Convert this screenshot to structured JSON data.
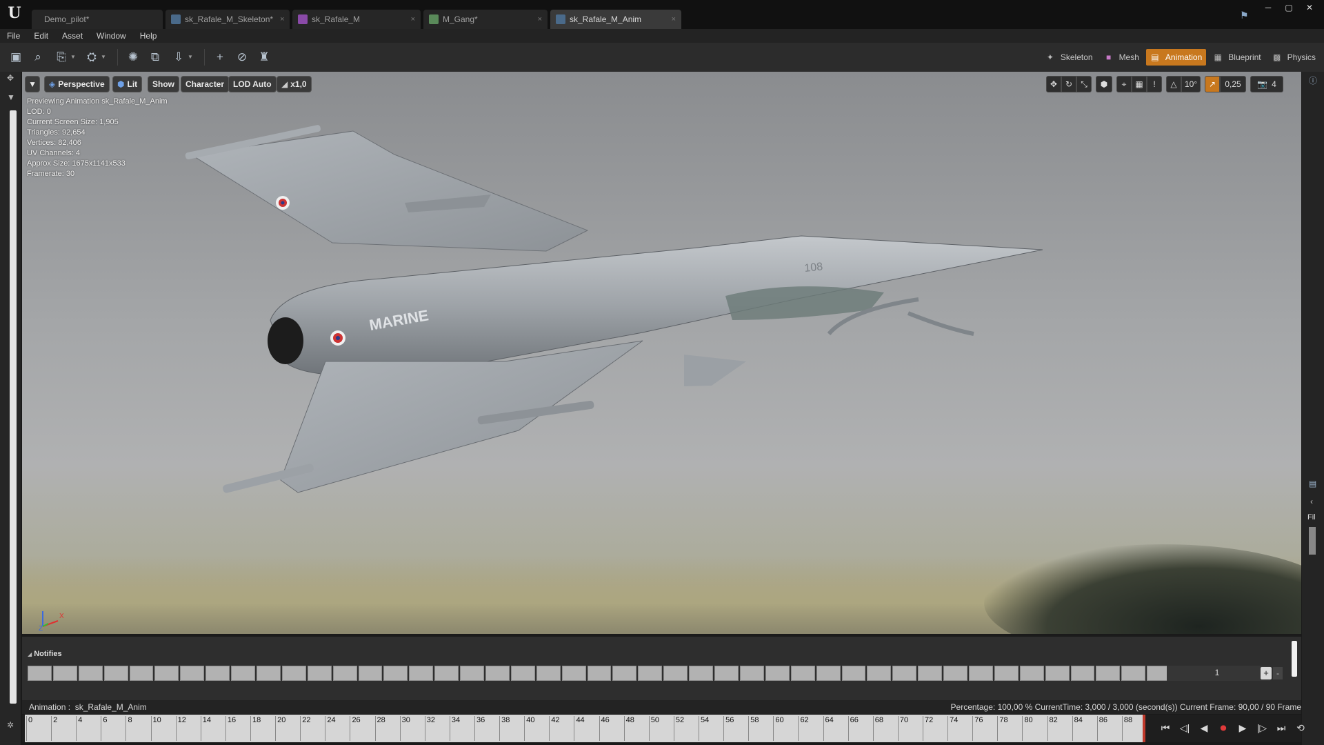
{
  "app": {
    "logo_text": "U"
  },
  "tabs": [
    {
      "label": "Demo_pilot*",
      "icon_color": "#3a3a3a",
      "close": ""
    },
    {
      "label": "sk_Rafale_M_Skeleton*",
      "icon_color": "#4a6a8a",
      "close": "×"
    },
    {
      "label": "sk_Rafale_M",
      "icon_color": "#8a4aa8",
      "close": "×"
    },
    {
      "label": "M_Gang*",
      "icon_color": "#5a8a5a",
      "close": "×"
    },
    {
      "label": "sk_Rafale_M_Anim",
      "icon_color": "#4a6a8a",
      "close": "×"
    }
  ],
  "menu": [
    "File",
    "Edit",
    "Asset",
    "Window",
    "Help"
  ],
  "modes": [
    {
      "label": "Skeleton",
      "icon": "skeleton-icon",
      "active": false
    },
    {
      "label": "Mesh",
      "icon": "mesh-icon",
      "active": false
    },
    {
      "label": "Animation",
      "icon": "animation-icon",
      "active": true
    },
    {
      "label": "Blueprint",
      "icon": "blueprint-icon",
      "active": false
    },
    {
      "label": "Physics",
      "icon": "physics-icon",
      "active": false
    }
  ],
  "viewport": {
    "buttons": {
      "perspective": "Perspective",
      "lit": "Lit",
      "show": "Show",
      "character": "Character",
      "lod": "LOD Auto",
      "speed": "x1,0"
    },
    "right_controls": {
      "rotation_snap": "10°",
      "scale_snap": "0,25",
      "camera_speed": "4"
    },
    "stats": [
      "Previewing Animation sk_Rafale_M_Anim",
      "LOD: 0",
      "Current Screen Size: 1,905",
      "Triangles: 92,654",
      "Vertices: 82,406",
      "UV Channels: 4",
      "Approx Size: 1675x1141x533",
      "Framerate: 30"
    ],
    "aircraft_marking": "MARINE",
    "aircraft_number": "108",
    "axis_x": "X",
    "axis_z": "Z"
  },
  "notifies": {
    "title": "Notifies",
    "track_number": "1",
    "add": "+",
    "remove": "-"
  },
  "status": {
    "animation_label": "Animation :",
    "animation_name": "sk_Rafale_M_Anim",
    "info": "Percentage:  100,00 % CurrentTime:  3,000 / 3,000 (second(s)) Current Frame:  90,00 / 90 Frame"
  },
  "timeline": {
    "ticks": [
      "0",
      "2",
      "4",
      "6",
      "8",
      "10",
      "12",
      "14",
      "16",
      "18",
      "20",
      "22",
      "24",
      "26",
      "28",
      "30",
      "32",
      "34",
      "36",
      "38",
      "40",
      "42",
      "44",
      "46",
      "48",
      "50",
      "52",
      "54",
      "56",
      "58",
      "60",
      "62",
      "64",
      "66",
      "68",
      "70",
      "72",
      "74",
      "76",
      "78",
      "80",
      "82",
      "84",
      "86",
      "88"
    ]
  },
  "right_panel": {
    "label": "Fil"
  }
}
